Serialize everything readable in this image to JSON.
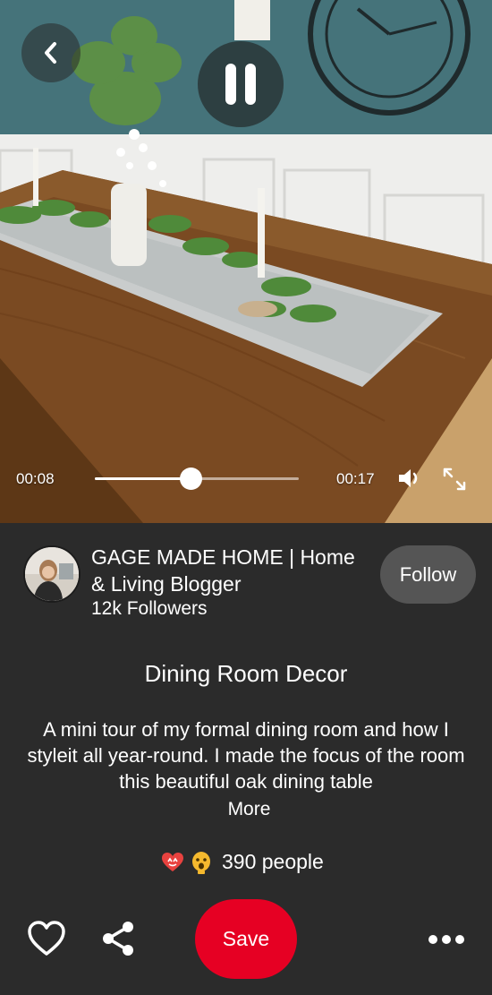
{
  "video": {
    "current_time": "00:08",
    "duration": "00:17",
    "progress": 0.47
  },
  "creator": {
    "name": "GAGE MADE HOME | Home & Living Blogger",
    "followers": "12k Followers",
    "follow_label": "Follow"
  },
  "pin": {
    "title": "Dining Room Decor",
    "description": "A mini tour of my formal dining room and how I styleit all year-round. I made the focus of the room this beautiful oak dining table",
    "more_label": "More"
  },
  "reactions": {
    "count_text": "390 people",
    "icons": [
      "heart-eyes-reaction",
      "wow-reaction"
    ]
  },
  "actions": {
    "save_label": "Save"
  },
  "colors": {
    "background": "#2b2b2b",
    "save": "#e60023",
    "follow": "#555555"
  }
}
